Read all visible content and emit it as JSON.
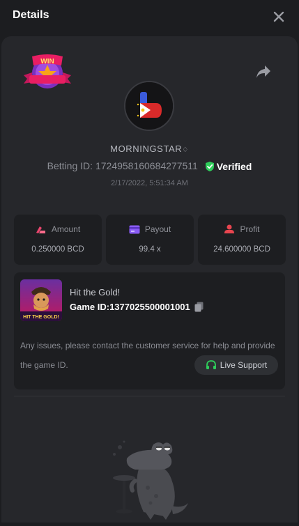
{
  "header": {
    "title": "Details"
  },
  "badge": {
    "text": "WIN"
  },
  "player": {
    "username": "MORNINGSTAR",
    "betting_id_label": "Betting ID:",
    "betting_id": "1724958160684277511",
    "verified_label": "Verified",
    "timestamp": "2/17/2022, 5:51:34 AM"
  },
  "stats": [
    {
      "label": "Amount",
      "value": "0.250000 BCD",
      "icon": "amount-icon"
    },
    {
      "label": "Payout",
      "value": "99.4 x",
      "icon": "payout-card-icon"
    },
    {
      "label": "Profit",
      "value": "24.600000 BCD",
      "icon": "profit-icon"
    }
  ],
  "game": {
    "name": "Hit the Gold!",
    "id_label": "Game ID:",
    "id": "1377025500001001",
    "thumb_text": "HIT THE GOLD!"
  },
  "support": {
    "notice": "Any issues, please contact the customer service for help and provide the game ID.",
    "button_label": "Live Support"
  },
  "colors": {
    "background": "#1c1d20",
    "panel": "#26272b",
    "card": "#1d1e21",
    "verified_green": "#2ecc5a",
    "amount_pink": "#e8456d",
    "payout_purple": "#8a5cf5",
    "profit_red": "#e8454f"
  }
}
